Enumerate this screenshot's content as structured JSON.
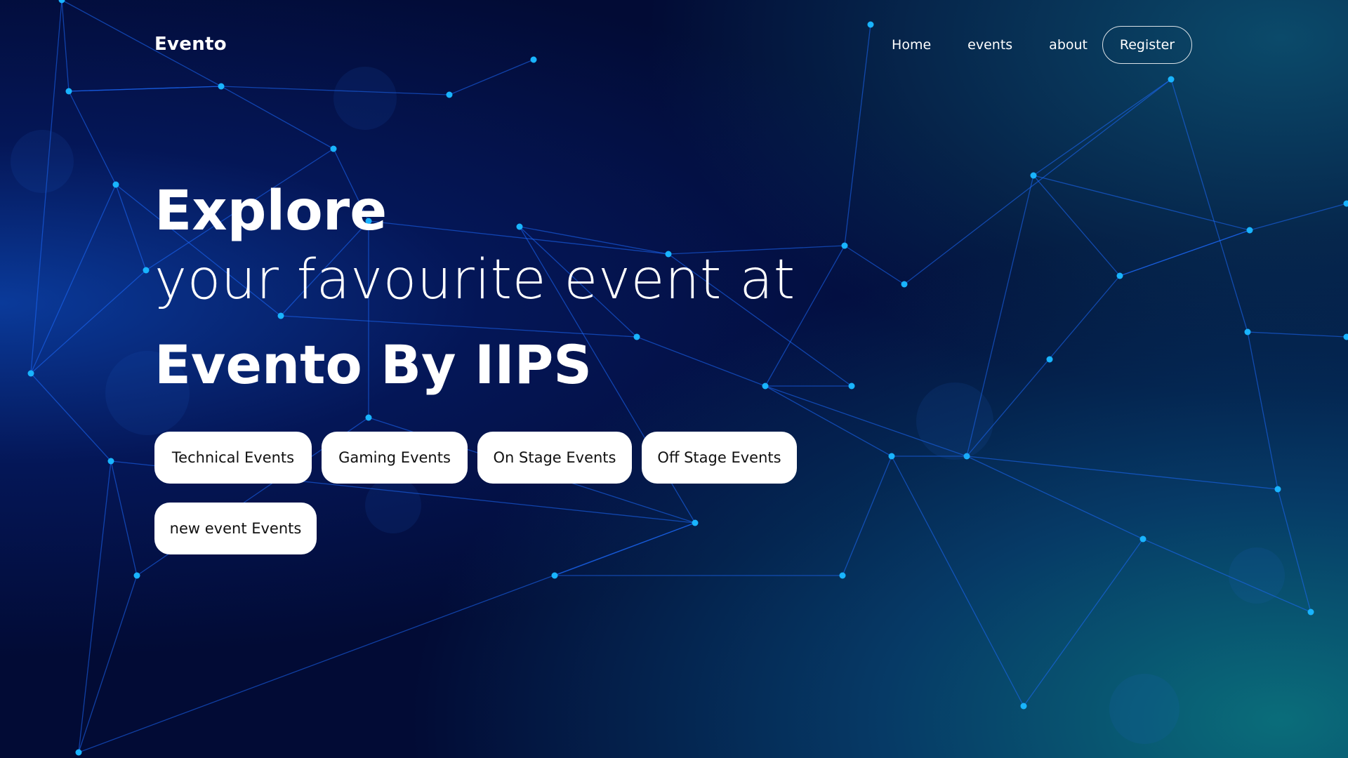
{
  "nav": {
    "brand": "Evento",
    "links": [
      "Home",
      "events",
      "about"
    ],
    "register_label": "Register"
  },
  "hero": {
    "line1": "Explore",
    "line2": "your favourite event at",
    "line3": "Evento By IIPS"
  },
  "categories": [
    "Technical Events",
    "Gaming Events",
    "On Stage Events",
    "Off Stage Events",
    "new event Events"
  ],
  "colors": {
    "background": "#020b35",
    "network_line": "#1e6bff",
    "network_node": "#19b4ff",
    "chip_bg": "#ffffff",
    "text": "#ffffff"
  }
}
